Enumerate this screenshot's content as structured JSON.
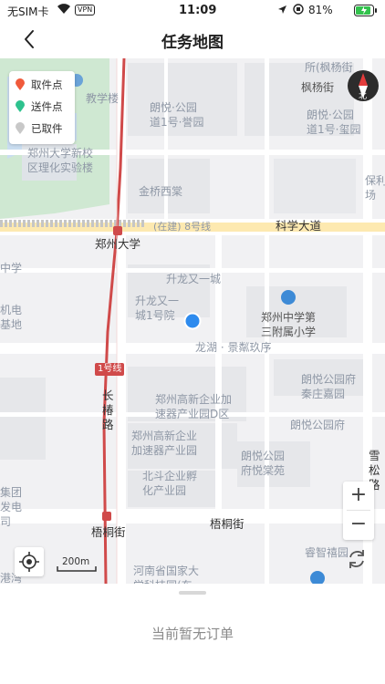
{
  "status_bar": {
    "carrier": "无SIM卡",
    "vpn": "VPN",
    "time": "11:09",
    "battery": "81%"
  },
  "nav": {
    "title": "任务地图"
  },
  "legend": {
    "items": [
      {
        "label": "取件点",
        "color": "#f05a3b"
      },
      {
        "label": "送件点",
        "color": "#2ec28e"
      },
      {
        "label": "已取件",
        "color": "#c8c8c8"
      }
    ]
  },
  "compass": {
    "label": "北"
  },
  "map_labels": {
    "lbl_jiaoxue": "教学楼",
    "lbl_fengyang_top": "所(枫杨街",
    "lbl_fengyang": "枫杨街",
    "lbl_langyue_yu": "朗悦·公园\n道1号·誉园",
    "lbl_langyue_xi": "朗悦·公园\n道1号·玺园",
    "lbl_zhengda": "郑州大学新校\n区理化实验楼",
    "lbl_baoli": "保利\n场",
    "lbl_jinqiao": "金桥西棠",
    "lbl_metro8": "(在建) 8号线",
    "lbl_kexue": "科学大道",
    "lbl_zhengzhou_uni": "郑州大学",
    "lbl_zhongxue_left": "中学",
    "lbl_shenglong": "升龙又一城",
    "lbl_shenglong1": "升龙又一\n城1号院",
    "lbl_fuxiao": "郑州中学第\n三附属小学",
    "lbl_jidian": "机电\n基地",
    "lbl_longhu": "龙湖 · 景粼玖序",
    "lbl_line1": "1号线",
    "lbl_changchun": "长\n椿\n路",
    "lbl_qinzhuang": "朗悦公园府\n秦庄嘉园",
    "lbl_gaoxin_d": "郑州高新企业加\n速器产业园D区",
    "lbl_langyue_fu": "朗悦公园府",
    "lbl_gaoxin": "郑州高新企业\n加速器产业园",
    "lbl_yuezhang": "朗悦公园\n府悦棠苑",
    "lbl_xuesong": "雪\n松\n路",
    "lbl_jituan": "集团\n发电\n司",
    "lbl_beidou": "北斗企业孵\n化产业园",
    "lbl_wutong_left": "梧桐街",
    "lbl_wutong": "梧桐街",
    "lbl_ruizhi": "睿智禧园",
    "lbl_henan": "河南省国家大\n学科技园(东",
    "lbl_gangwan": "港湾"
  },
  "scale": {
    "label": "200m"
  },
  "zoom": {
    "in": "+",
    "out": "−"
  },
  "panel": {
    "empty_text": "当前暂无订单"
  }
}
